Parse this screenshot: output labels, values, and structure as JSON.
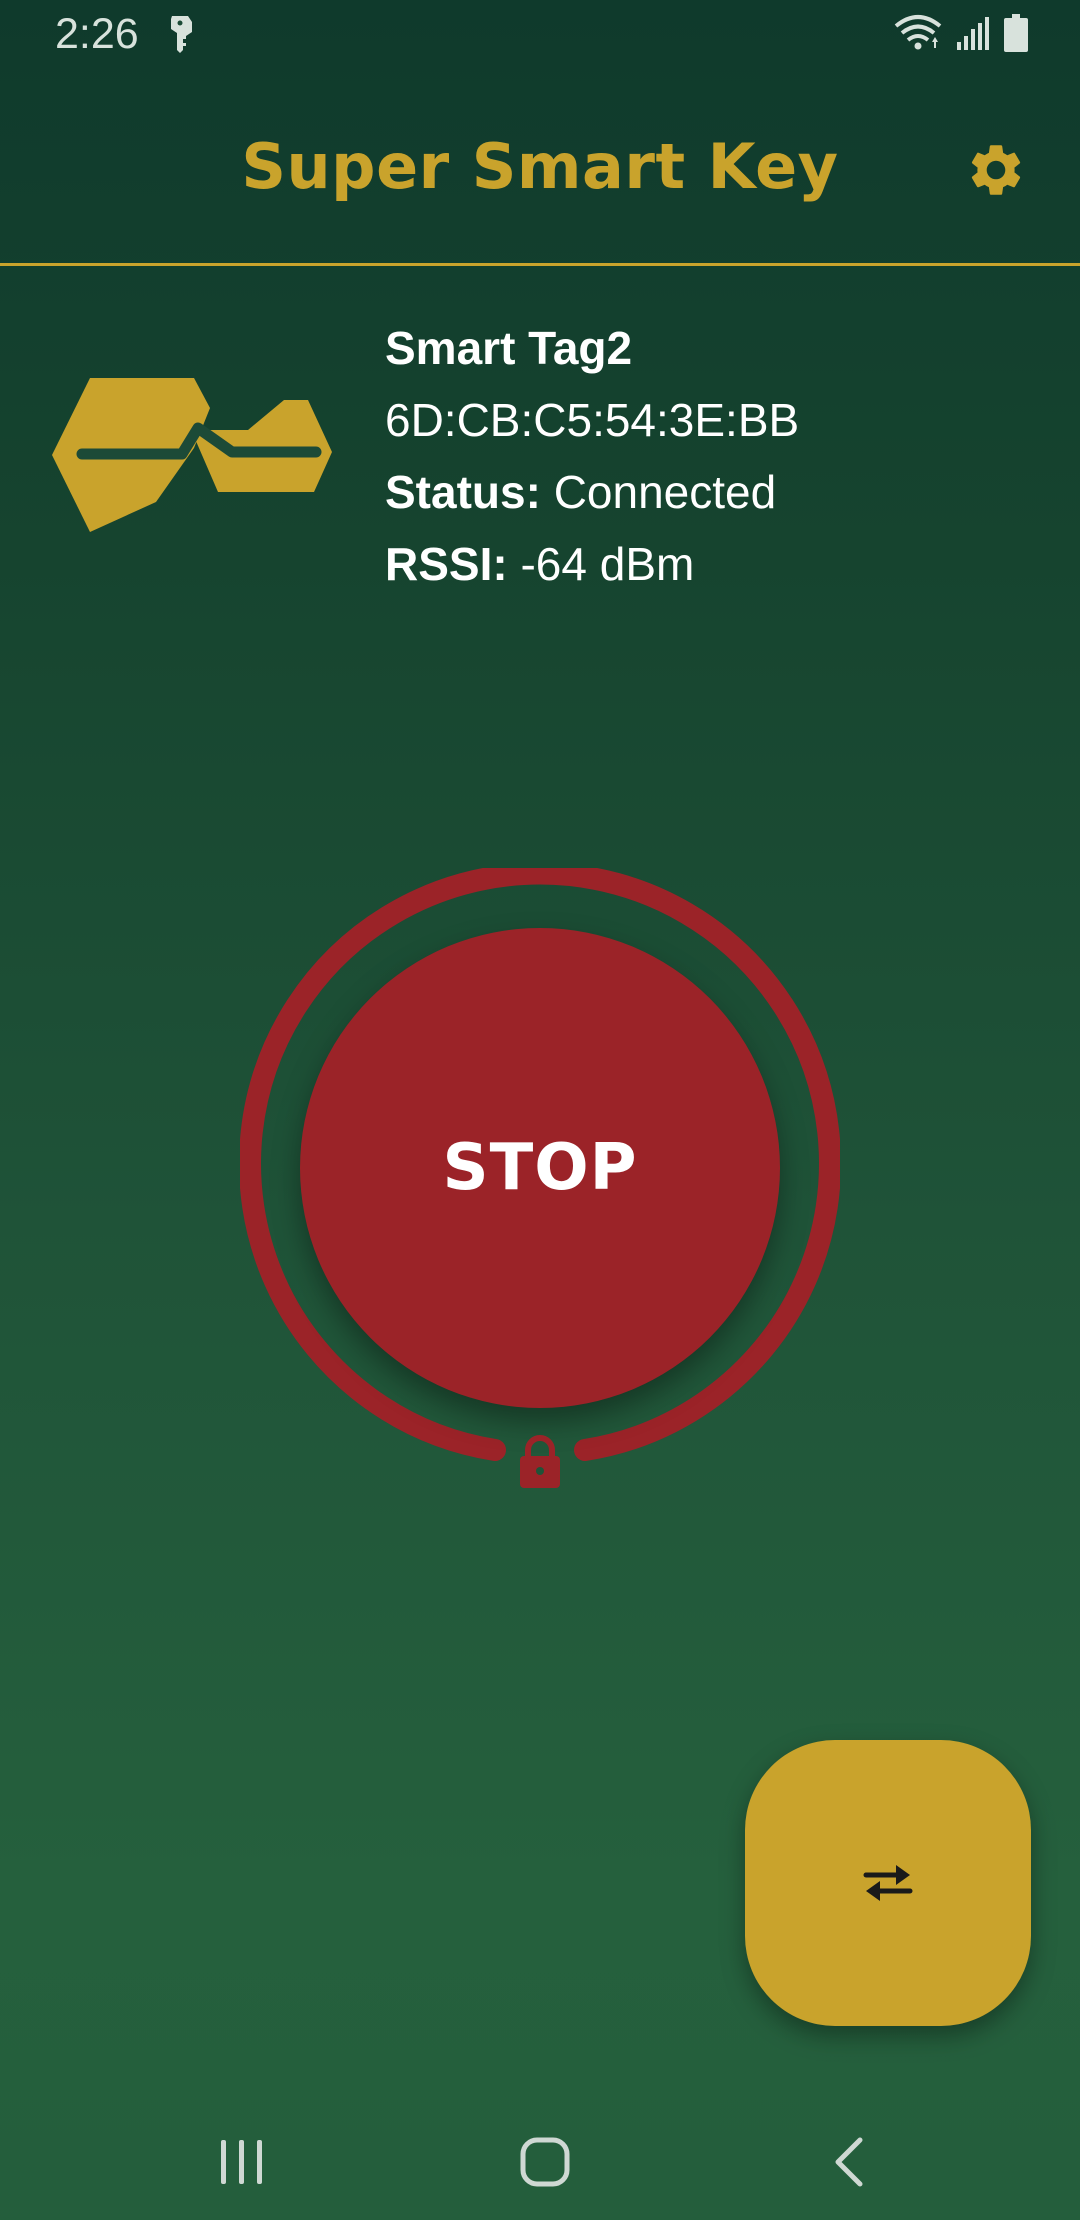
{
  "status_bar": {
    "time": "2:26",
    "icons": [
      "key-icon",
      "wifi-icon",
      "signal-icon",
      "battery-icon"
    ]
  },
  "app_bar": {
    "title": "Super Smart Key",
    "settings_icon": "gear-icon"
  },
  "device": {
    "name": "Smart Tag2",
    "mac": "6D:CB:C5:54:3E:BB",
    "status_label": "Status:",
    "status_value": "Connected",
    "rssi_label": "RSSI:",
    "rssi_value": "-64 dBm"
  },
  "control": {
    "stop_label": "STOP",
    "lock_icon": "lock-icon"
  },
  "fab": {
    "icon": "swap-arrows-icon"
  },
  "nav": {
    "items": [
      "recent-apps-icon",
      "home-icon",
      "back-icon"
    ]
  },
  "colors": {
    "accent": "#c9a32c",
    "stop_red": "#9b2328",
    "background_top": "#0f3a2c",
    "background_bottom": "#25603d"
  }
}
